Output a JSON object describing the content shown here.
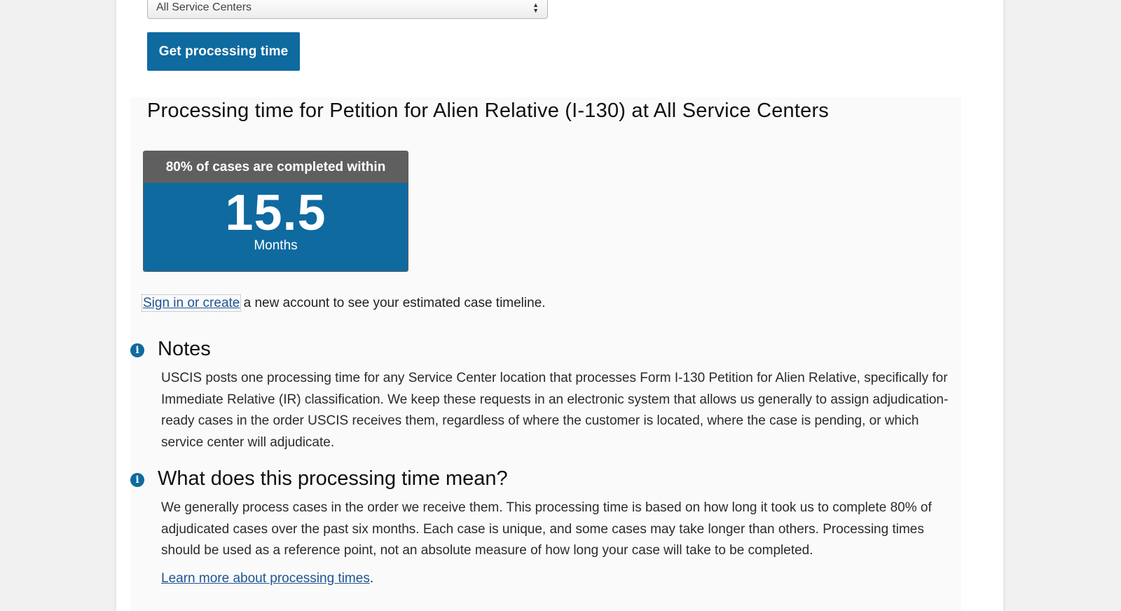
{
  "form": {
    "service_center_select": "All Service Centers",
    "submit_label": "Get processing time"
  },
  "results": {
    "title": "Processing time for Petition for Alien Relative (I-130) at All Service Centers",
    "card": {
      "header": "80% of cases are completed within",
      "value": "15.5",
      "unit": "Months"
    },
    "signin_link": "Sign in or create",
    "signin_rest": " a new account to see your estimated case timeline."
  },
  "notes": {
    "icon": "info-icon",
    "title": "Notes",
    "text": "USCIS posts one processing time for any Service Center location that processes Form I-130 Petition for Alien Relative, specifically for Immediate Relative (IR) classification.  We keep these requests in an electronic system that allows us generally to assign adjudication-ready cases in the order USCIS receives them, regardless of where the customer is located, where the case is pending, or which service center will adjudicate."
  },
  "meaning": {
    "icon": "info-icon",
    "title": "What does this processing time mean?",
    "text": "We generally process cases in the order we receive them. This processing time is based on how long it took us to complete 80% of adjudicated cases over the past six months. Each case is unique, and some cases may take longer than others. Processing times should be used as a reference point, not an absolute measure of how long your case will take to be completed.",
    "learn_link": "Learn more about processing times",
    "learn_suffix": "."
  },
  "colors": {
    "primary_blue": "#0f6aa0",
    "card_header_gray": "#5f5f5f",
    "link_blue": "#205493"
  }
}
